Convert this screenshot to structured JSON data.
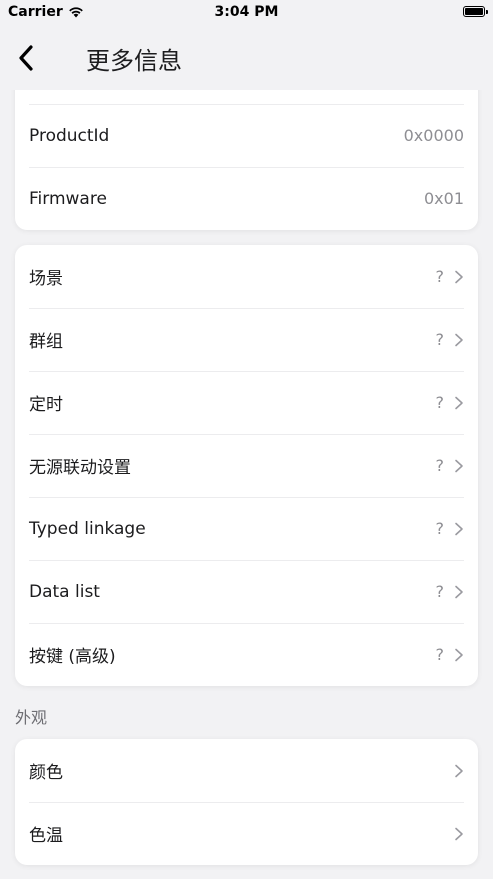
{
  "status_bar": {
    "carrier": "Carrier",
    "time": "3:04 PM"
  },
  "nav": {
    "title": "更多信息"
  },
  "info_card": {
    "rows": [
      {
        "label": "ProductId",
        "value": "0x0000"
      },
      {
        "label": "Firmware",
        "value": "0x01"
      }
    ]
  },
  "features_card": {
    "rows": [
      {
        "label": "场景",
        "value": "?"
      },
      {
        "label": "群组",
        "value": "?"
      },
      {
        "label": "定时",
        "value": "?"
      },
      {
        "label": "无源联动设置",
        "value": "?"
      },
      {
        "label": "Typed linkage",
        "value": "?"
      },
      {
        "label": "Data list",
        "value": "?"
      },
      {
        "label": "按键 (高级)",
        "value": "?"
      }
    ]
  },
  "appearance": {
    "section_title": "外观",
    "rows": [
      {
        "label": "颜色"
      },
      {
        "label": "色温"
      }
    ]
  }
}
